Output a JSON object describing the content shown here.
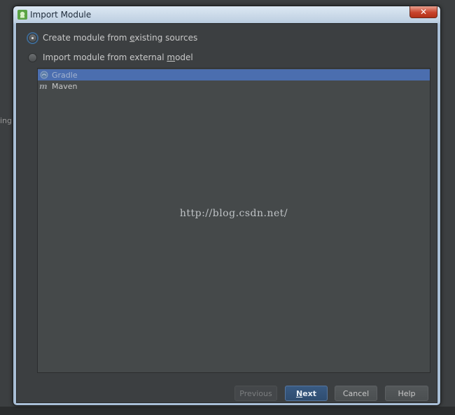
{
  "background": {
    "fragment_text": "ing"
  },
  "window": {
    "title": "Import Module",
    "close_glyph": "✕"
  },
  "options": [
    {
      "label_pre": "Create module from ",
      "mnemonic": "e",
      "label_post": "xisting sources",
      "selected": true
    },
    {
      "label_pre": "Import module from external ",
      "mnemonic": "m",
      "label_post": "odel",
      "selected": false
    }
  ],
  "list": {
    "items": [
      {
        "label": "Gradle",
        "icon": "gradle-icon",
        "selected": true
      },
      {
        "label": "Maven",
        "icon": "maven-icon",
        "selected": false
      }
    ]
  },
  "watermark": "http://blog.csdn.net/",
  "buttons": {
    "previous": "Previous",
    "next_mnemonic": "N",
    "next_rest": "ext",
    "cancel": "Cancel",
    "help": "Help"
  },
  "colors": {
    "selection": "#4b6eaf",
    "panel": "#3c3f41",
    "primary_button": "#395a82"
  }
}
